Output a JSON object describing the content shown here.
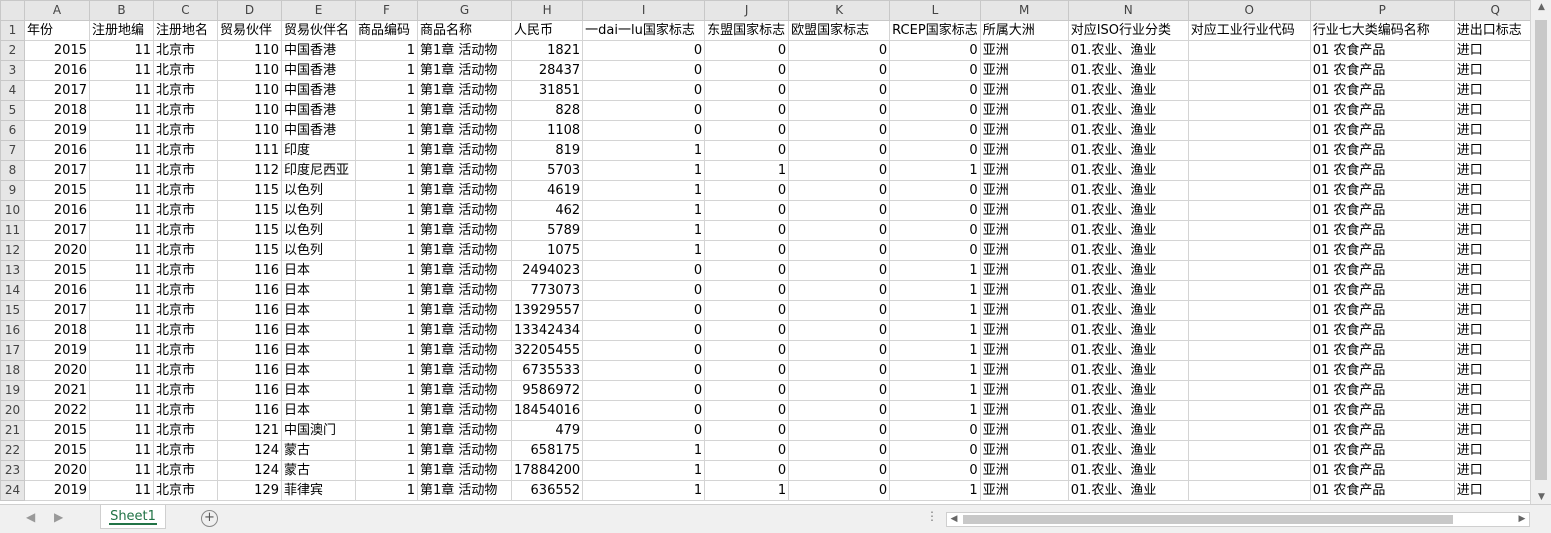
{
  "columns": [
    "A",
    "B",
    "C",
    "D",
    "E",
    "F",
    "G",
    "H",
    "I",
    "J",
    "K",
    "L",
    "M",
    "N",
    "O",
    "P",
    "Q"
  ],
  "header_row": [
    "年份",
    "注册地编",
    "注册地名",
    "贸易伙伴",
    "贸易伙伴名",
    "商品编码",
    "商品名称",
    "人民币",
    "一dai一lu国家标志",
    "东盟国家标志",
    "欧盟国家标志",
    "RCEP国家标志",
    "所属大洲",
    "对应ISO行业分类",
    "对应工业行业代码",
    "行业七大类编码名称",
    "进出口标志"
  ],
  "rows": [
    [
      "2015",
      "11",
      "北京市",
      "110",
      "中国香港",
      "1",
      "第1章  活动物",
      "1821",
      "0",
      "0",
      "0",
      "0",
      "亚洲",
      "01.农业、渔业",
      "",
      "01 农食产品",
      "进口"
    ],
    [
      "2016",
      "11",
      "北京市",
      "110",
      "中国香港",
      "1",
      "第1章  活动物",
      "28437",
      "0",
      "0",
      "0",
      "0",
      "亚洲",
      "01.农业、渔业",
      "",
      "01 农食产品",
      "进口"
    ],
    [
      "2017",
      "11",
      "北京市",
      "110",
      "中国香港",
      "1",
      "第1章  活动物",
      "31851",
      "0",
      "0",
      "0",
      "0",
      "亚洲",
      "01.农业、渔业",
      "",
      "01 农食产品",
      "进口"
    ],
    [
      "2018",
      "11",
      "北京市",
      "110",
      "中国香港",
      "1",
      "第1章  活动物",
      "828",
      "0",
      "0",
      "0",
      "0",
      "亚洲",
      "01.农业、渔业",
      "",
      "01 农食产品",
      "进口"
    ],
    [
      "2019",
      "11",
      "北京市",
      "110",
      "中国香港",
      "1",
      "第1章  活动物",
      "1108",
      "0",
      "0",
      "0",
      "0",
      "亚洲",
      "01.农业、渔业",
      "",
      "01 农食产品",
      "进口"
    ],
    [
      "2016",
      "11",
      "北京市",
      "111",
      "印度",
      "1",
      "第1章  活动物",
      "819",
      "1",
      "0",
      "0",
      "0",
      "亚洲",
      "01.农业、渔业",
      "",
      "01 农食产品",
      "进口"
    ],
    [
      "2017",
      "11",
      "北京市",
      "112",
      "印度尼西亚",
      "1",
      "第1章  活动物",
      "5703",
      "1",
      "1",
      "0",
      "1",
      "亚洲",
      "01.农业、渔业",
      "",
      "01 农食产品",
      "进口"
    ],
    [
      "2015",
      "11",
      "北京市",
      "115",
      "以色列",
      "1",
      "第1章  活动物",
      "4619",
      "1",
      "0",
      "0",
      "0",
      "亚洲",
      "01.农业、渔业",
      "",
      "01 农食产品",
      "进口"
    ],
    [
      "2016",
      "11",
      "北京市",
      "115",
      "以色列",
      "1",
      "第1章  活动物",
      "462",
      "1",
      "0",
      "0",
      "0",
      "亚洲",
      "01.农业、渔业",
      "",
      "01 农食产品",
      "进口"
    ],
    [
      "2017",
      "11",
      "北京市",
      "115",
      "以色列",
      "1",
      "第1章  活动物",
      "5789",
      "1",
      "0",
      "0",
      "0",
      "亚洲",
      "01.农业、渔业",
      "",
      "01 农食产品",
      "进口"
    ],
    [
      "2020",
      "11",
      "北京市",
      "115",
      "以色列",
      "1",
      "第1章  活动物",
      "1075",
      "1",
      "0",
      "0",
      "0",
      "亚洲",
      "01.农业、渔业",
      "",
      "01 农食产品",
      "进口"
    ],
    [
      "2015",
      "11",
      "北京市",
      "116",
      "日本",
      "1",
      "第1章  活动物",
      "2494023",
      "0",
      "0",
      "0",
      "1",
      "亚洲",
      "01.农业、渔业",
      "",
      "01 农食产品",
      "进口"
    ],
    [
      "2016",
      "11",
      "北京市",
      "116",
      "日本",
      "1",
      "第1章  活动物",
      "773073",
      "0",
      "0",
      "0",
      "1",
      "亚洲",
      "01.农业、渔业",
      "",
      "01 农食产品",
      "进口"
    ],
    [
      "2017",
      "11",
      "北京市",
      "116",
      "日本",
      "1",
      "第1章  活动物",
      "13929557",
      "0",
      "0",
      "0",
      "1",
      "亚洲",
      "01.农业、渔业",
      "",
      "01 农食产品",
      "进口"
    ],
    [
      "2018",
      "11",
      "北京市",
      "116",
      "日本",
      "1",
      "第1章  活动物",
      "13342434",
      "0",
      "0",
      "0",
      "1",
      "亚洲",
      "01.农业、渔业",
      "",
      "01 农食产品",
      "进口"
    ],
    [
      "2019",
      "11",
      "北京市",
      "116",
      "日本",
      "1",
      "第1章  活动物",
      "32205455",
      "0",
      "0",
      "0",
      "1",
      "亚洲",
      "01.农业、渔业",
      "",
      "01 农食产品",
      "进口"
    ],
    [
      "2020",
      "11",
      "北京市",
      "116",
      "日本",
      "1",
      "第1章  活动物",
      "6735533",
      "0",
      "0",
      "0",
      "1",
      "亚洲",
      "01.农业、渔业",
      "",
      "01 农食产品",
      "进口"
    ],
    [
      "2021",
      "11",
      "北京市",
      "116",
      "日本",
      "1",
      "第1章  活动物",
      "9586972",
      "0",
      "0",
      "0",
      "1",
      "亚洲",
      "01.农业、渔业",
      "",
      "01 农食产品",
      "进口"
    ],
    [
      "2022",
      "11",
      "北京市",
      "116",
      "日本",
      "1",
      "第1章  活动物",
      "18454016",
      "0",
      "0",
      "0",
      "1",
      "亚洲",
      "01.农业、渔业",
      "",
      "01 农食产品",
      "进口"
    ],
    [
      "2015",
      "11",
      "北京市",
      "121",
      "中国澳门",
      "1",
      "第1章  活动物",
      "479",
      "0",
      "0",
      "0",
      "0",
      "亚洲",
      "01.农业、渔业",
      "",
      "01 农食产品",
      "进口"
    ],
    [
      "2015",
      "11",
      "北京市",
      "124",
      "蒙古",
      "1",
      "第1章  活动物",
      "658175",
      "1",
      "0",
      "0",
      "0",
      "亚洲",
      "01.农业、渔业",
      "",
      "01 农食产品",
      "进口"
    ],
    [
      "2020",
      "11",
      "北京市",
      "124",
      "蒙古",
      "1",
      "第1章  活动物",
      "17884200",
      "1",
      "0",
      "0",
      "0",
      "亚洲",
      "01.农业、渔业",
      "",
      "01 农食产品",
      "进口"
    ],
    [
      "2019",
      "11",
      "北京市",
      "129",
      "菲律宾",
      "1",
      "第1章  活动物",
      "636552",
      "1",
      "1",
      "0",
      "1",
      "亚洲",
      "01.农业、渔业",
      "",
      "01 农食产品",
      "进口"
    ]
  ],
  "sheet_tab": "Sheet1",
  "add_sheet_icon": "plus-circle-icon",
  "nav_prev_icon": "triangle-left-icon",
  "nav_next_icon": "triangle-right-icon",
  "more_dots": "⋮",
  "colors": {
    "header_bg": "#e6e6e6",
    "grid": "#d4d4d4",
    "tab_accent": "#217346"
  }
}
